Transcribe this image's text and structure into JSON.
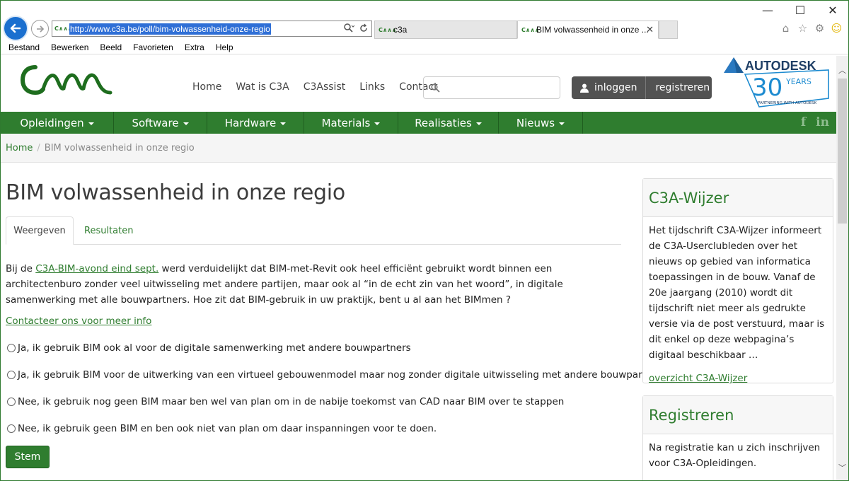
{
  "browser": {
    "url": "http://www.c3a.be/poll/bim-volwassenheid-onze-regio",
    "tab_favicon_text": "C∧∧∧",
    "tabs": [
      {
        "label": "c3a"
      },
      {
        "label": "BIM volwassenheid in onze ...",
        "close": "✕"
      }
    ],
    "menu": [
      "Bestand",
      "Bewerken",
      "Beeld",
      "Favorieten",
      "Extra",
      "Help"
    ],
    "window_controls": {
      "minimize": "—",
      "maximize": "☐",
      "close": "✕"
    }
  },
  "header": {
    "top_nav": [
      "Home",
      "Wat is C3A",
      "C3Assist",
      "Links",
      "Contact"
    ],
    "search_placeholder": "",
    "login_label": "inloggen",
    "register_label": "registreren",
    "autodesk": {
      "brand": "AUTODESK",
      "years": "30",
      "years_word": "YEARS",
      "tagline": "PARTNERING WITH AUTODESK"
    }
  },
  "main_nav": [
    "Opleidingen",
    "Software",
    "Hardware",
    "Materials",
    "Realisaties",
    "Nieuws"
  ],
  "social": {
    "facebook": "f",
    "linkedin": "in"
  },
  "breadcrumb": {
    "home": "Home",
    "separator": "/",
    "current": "BIM volwassenheid in onze regio"
  },
  "page": {
    "title": "BIM volwassenheid in onze regio",
    "tabs": {
      "view": "Weergeven",
      "results": "Resultaten"
    },
    "intro_before": "Bij de ",
    "intro_link": "C3A-BIM-avond eind sept.",
    "intro_after": " werd verduidelijkt dat BIM-met-Revit ook heel efficiënt gebruikt wordt binnen een architectenburo zonder veel uitwisseling met andere partijen, maar ook al “in de echt zin van het woord”, in digitale samenwerking met alle bouwpartners. Hoe zit dat BIM-gebruik in uw praktijk, bent u al aan het BIMmen ?",
    "contact_link": "Contacteer ons voor meer info",
    "options": [
      "Ja, ik gebruik BIM ook al voor de digitale samenwerking met andere bouwpartners",
      "Ja, ik gebruik BIM voor de uitwerking van een virtueel gebouwenmodel maar nog zonder digitale uitwisseling met andere bouwpart",
      "Nee, ik gebruik nog geen BIM maar ben wel van plan om in de nabije toekomst van CAD naar BIM over te stappen",
      "Nee, ik gebruik geen BIM en ben ook niet van plan om daar inspanningen voor te doen."
    ],
    "vote_button": "Stem"
  },
  "sidebar": {
    "wijzer": {
      "title": "C3A-Wijzer",
      "body": "Het tijdschrift C3A-Wijzer informeert de C3A-Userclubleden over het nieuws op gebied van informatica toepassingen in de bouw. Vanaf de 20e jaargang (2010) wordt dit tijdschrift niet meer als gedrukte versie via de post verstuurd, maar is dit enkel op deze webpagina’s digitaal beschikbaar …",
      "link": "overzicht C3A-Wijzer"
    },
    "registreren": {
      "title": "Registreren",
      "body": "Na registratie kan u zich inschrijven voor C3A-Opleidingen."
    }
  }
}
